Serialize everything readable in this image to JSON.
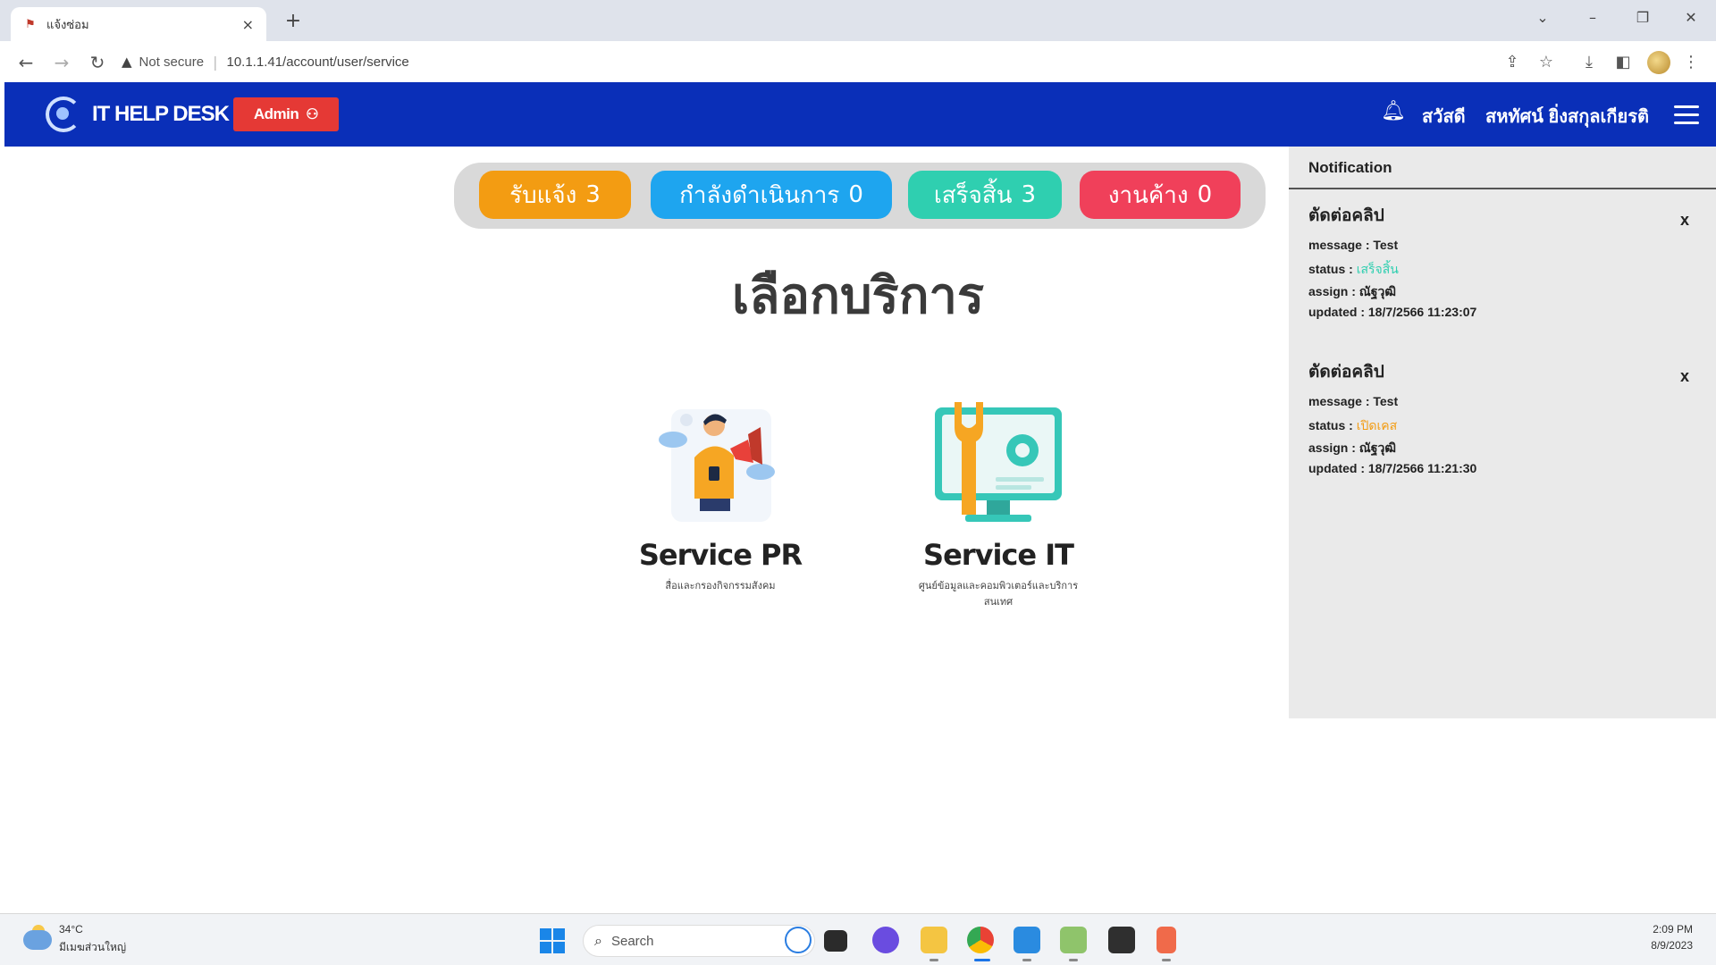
{
  "browser": {
    "tab_title": "แจ้งซ่อม",
    "tab_close": "×",
    "new_tab": "+",
    "security_label": "Not secure",
    "url": "10.1.1.41/account/user/service"
  },
  "navbar": {
    "brand": "IT HELP DESK",
    "admin_label": "Admin",
    "greeting": "สวัสดี",
    "user_name": "สหทัศน์ ยิ่งสกุลเกียรติ"
  },
  "status_pills": [
    {
      "label": "รับแจ้ง",
      "count": "3",
      "color": "#f39c12"
    },
    {
      "label": "กำลังดำเนินการ",
      "count": "0",
      "color": "#1ea5ef"
    },
    {
      "label": "เสร็จสิ้น",
      "count": "3",
      "color": "#2fcfb0"
    },
    {
      "label": "งานค้าง",
      "count": "0",
      "color": "#f0405a"
    }
  ],
  "page_title": "เลือกบริการ",
  "services": [
    {
      "name": "Service PR",
      "description": "สื่อและกรองกิจกรรมสังคม",
      "icon": "megaphone-person-icon"
    },
    {
      "name": "Service IT",
      "description": "ศูนย์ข้อมูลและคอมพิวเตอร์และบริการสนเทศ",
      "icon": "wrench-gear-monitor-icon"
    }
  ],
  "notifications": {
    "header": "Notification",
    "items": [
      {
        "title": "ตัดต่อคลิป",
        "message_label": "message :",
        "message": "Test",
        "status_label": "status :",
        "status": "เสร็จสิ้น",
        "status_color": "#2fcfb0",
        "assign_label": "assign :",
        "assign": "ณัฐวุฒิ",
        "updated_label": "updated :",
        "updated": "18/7/2566 11:23:07",
        "close": "x"
      },
      {
        "title": "ตัดต่อคลิป",
        "message_label": "message :",
        "message": "Test",
        "status_label": "status :",
        "status": "เปิดเคส",
        "status_color": "#f39c12",
        "assign_label": "assign :",
        "assign": "ณัฐวุฒิ",
        "updated_label": "updated :",
        "updated": "18/7/2566 11:21:30",
        "close": "x"
      }
    ]
  },
  "taskbar": {
    "weather_temp": "34°C",
    "weather_desc": "มีเมฆส่วนใหญ่",
    "search_placeholder": "Search",
    "time": "2:09 PM",
    "date": "8/9/2023"
  },
  "colors": {
    "navbar": "#0a2fb8",
    "admin_badge": "#e53935"
  }
}
